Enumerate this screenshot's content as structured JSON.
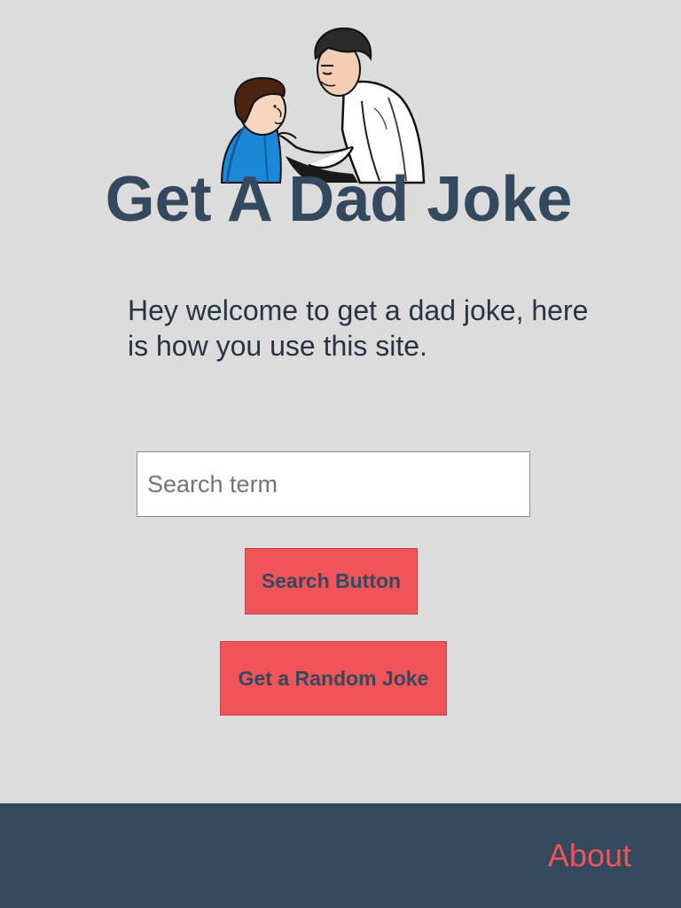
{
  "header": {
    "title": "Get A Dad Joke",
    "hero_image": "dad-and-son-illustration"
  },
  "intro": {
    "text": "Hey welcome to get a dad joke, here is how you use this site."
  },
  "search": {
    "placeholder": "Search term",
    "value": "",
    "button_label": "Search Button"
  },
  "random": {
    "button_label": "Get a Random Joke"
  },
  "footer": {
    "about_label": "About"
  },
  "colors": {
    "background": "#dcdcdd",
    "primary_dark": "#34495e",
    "accent_red": "#f05458",
    "footer_bg": "#34495e"
  }
}
